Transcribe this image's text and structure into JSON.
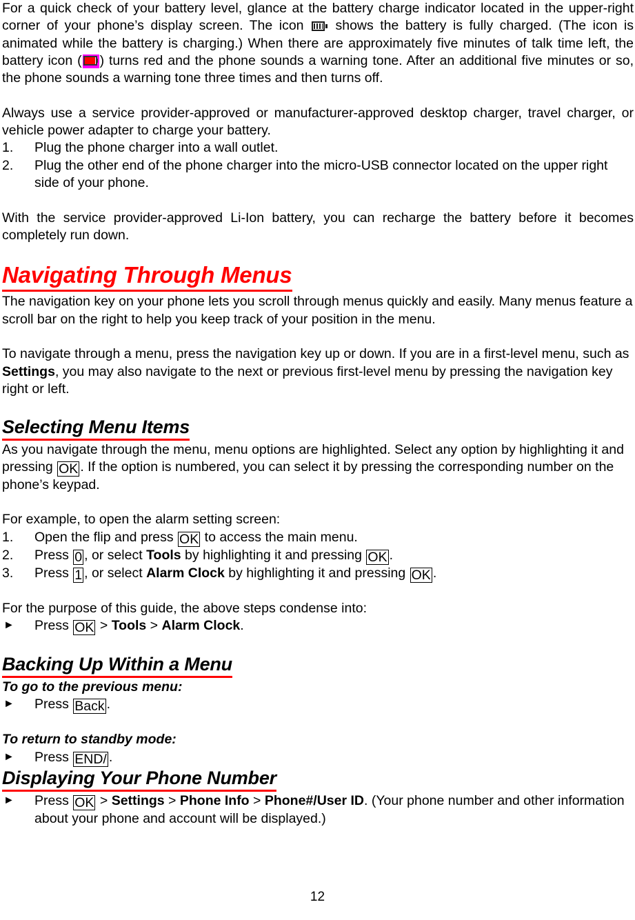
{
  "document": {
    "page_number": "12"
  },
  "battery_section": {
    "p1_part1": "For a  quick check of your battery level, glance at the battery charge indicator located in the upper-right corner of your phone’s display screen. The icon ",
    "icon_full_name": "battery-full-icon",
    "p1_part2": " shows the battery is fully charged. (The icon is animated while the battery is charging.) When there are approximately five minutes of talk time left, the battery icon (",
    "icon_low_name": "battery-low-red-icon",
    "p1_part3": ") turns red and the phone sounds a warning tone. After an additional five minutes or so, the phone sounds a warning tone three times and then turns off.",
    "p2": "Always use a service provider-approved or manufacturer-approved desktop charger, travel charger, or vehicle power adapter to charge your battery.",
    "steps": [
      {
        "num": "1.",
        "text": "Plug the phone charger into a wall outlet."
      },
      {
        "num": "2.",
        "text": "Plug the other end of the phone charger into the micro-USB connector located on the upper right side of your phone."
      }
    ],
    "p3": "With the service provider-approved Li-Ion battery, you can recharge the battery before it becomes completely run down."
  },
  "navigating": {
    "heading": "Navigating Through Menus",
    "heading_color": "#FF0000",
    "p1": "The navigation key on your phone lets you scroll through menus quickly and easily. Many menus feature a scroll bar on the right to help you keep track of your position in the menu.",
    "p2_part1": "To navigate through a menu, press the navigation key up or down. If you are in a first-level menu, such as ",
    "p2_bold": "Settings",
    "p2_part2": ", you may also navigate to the next or previous first-level menu by pressing the navigation key right or left."
  },
  "selecting": {
    "heading": "Selecting Menu Items",
    "underline_color": "#FF0000",
    "p1_part1": "As you navigate through the menu, menu options are highlighted. Select any option by highlighting it and pressing ",
    "key_ok": "OK",
    "p1_part2": ". If the option is numbered, you can select it by pressing the corresponding number on the phone’s keypad.",
    "example_intro": "For example, to open the alarm setting screen:",
    "steps": [
      {
        "num": "1.",
        "pre": "Open the flip and press ",
        "key": "OK",
        "post": " to access the main menu.",
        "bold": "",
        "mid": ""
      },
      {
        "num": "2.",
        "pre": "Press ",
        "key": "0",
        "mid": ", or select ",
        "bold": "Tools",
        "mid2": " by highlighting it and pressing ",
        "key2": "OK",
        "post": "."
      },
      {
        "num": "3.",
        "pre": "Press ",
        "key": "1",
        "mid": ", or select ",
        "bold": "Alarm Clock",
        "mid2": " by highlighting it and pressing ",
        "key2": "OK",
        "post": "."
      }
    ],
    "condense_intro": "For the purpose of this guide, the above steps condense into:",
    "condense_bullet": {
      "bullet": "►",
      "pre": "Press ",
      "key": "OK",
      "sep1": " > ",
      "bold1": "Tools",
      "sep2": " > ",
      "bold2": "Alarm Clock",
      "post": "."
    }
  },
  "backing_up": {
    "heading": "Backing Up Within a Menu",
    "underline_color": "#FF0000",
    "sub1": "To go to the previous menu:",
    "bullet1": {
      "bullet": "►",
      "pre": "Press ",
      "key": "Back",
      "post": "."
    },
    "sub2": "To return to standby mode:",
    "bullet2": {
      "bullet": "►",
      "pre": "Press ",
      "key": "END/",
      "post": "."
    }
  },
  "displaying": {
    "heading": "Displaying Your Phone Number",
    "underline_color": "#FF0000",
    "bullet": {
      "bullet": "►",
      "pre": "Press ",
      "key": "OK",
      "sep1": " > ",
      "bold1": "Settings",
      "sep2": " > ",
      "bold2": "Phone Info",
      "sep3": " > ",
      "bold3": "Phone#/User ID",
      "post": ". (Your phone number and other information about your phone and account will be displayed.)"
    }
  }
}
